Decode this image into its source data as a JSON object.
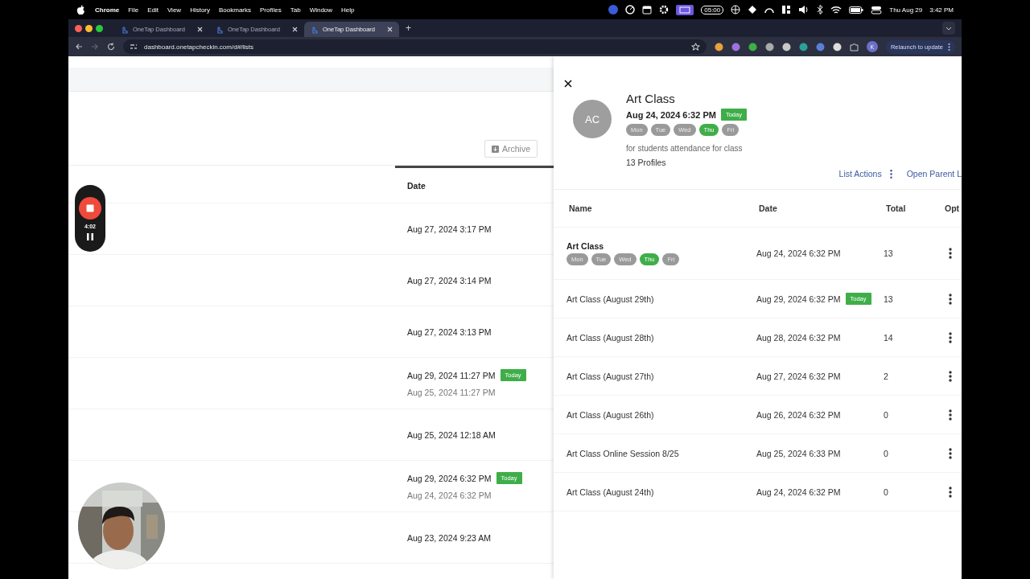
{
  "menu_bar": {
    "app": "Chrome",
    "items": [
      "File",
      "Edit",
      "View",
      "History",
      "Bookmarks",
      "Profiles",
      "Tab",
      "Window",
      "Help"
    ],
    "timer": "05:00",
    "date": "Thu Aug 29",
    "time": "3:42 PM"
  },
  "browser": {
    "tabs": [
      {
        "title": "OneTap Dashboard",
        "selected": false
      },
      {
        "title": "OneTap Dashboard",
        "selected": false
      },
      {
        "title": "OneTap Dashboard",
        "selected": true
      }
    ],
    "new_tab": "+",
    "url": "dashboard.onetapcheckin.com/d#/lists",
    "profile": "K",
    "relaunch": "Relaunch to update"
  },
  "list_page": {
    "archive_button": "Archive",
    "date_header": "Date",
    "rows": [
      {
        "date": "Aug 27, 2024 3:17 PM"
      },
      {
        "date": "Aug 27, 2024 3:14 PM"
      },
      {
        "date": "Aug 27, 2024 3:13 PM"
      },
      {
        "date": "Aug 29, 2024 11:27 PM",
        "badge": "Today",
        "original_date": "Aug 25, 2024 11:27 PM"
      },
      {
        "date": "Aug 25, 2024 12:18 AM"
      },
      {
        "date": "Aug 29, 2024 6:32 PM",
        "badge": "Today",
        "original_date": "Aug 24, 2024 6:32 PM"
      },
      {
        "date": "Aug 23, 2024 9:23 AM"
      }
    ]
  },
  "recorder": {
    "elapsed": "4:02"
  },
  "detail_panel": {
    "initials": "AC",
    "title": "Art Class",
    "date": "Aug 24, 2024 6:32 PM",
    "badge": "Today",
    "days": [
      {
        "label": "Mon",
        "selected": false
      },
      {
        "label": "Tue",
        "selected": false
      },
      {
        "label": "Wed",
        "selected": false
      },
      {
        "label": "Thu",
        "selected": true
      },
      {
        "label": "Fri",
        "selected": false
      }
    ],
    "description": "for students attendance for class",
    "profiles": "13 Profiles",
    "list_actions": "List Actions",
    "open_parent": "Open Parent L",
    "columns": [
      "Name",
      "Date",
      "Total",
      "Opt"
    ],
    "rows": [
      {
        "kind": "recurring",
        "name": "Art Class",
        "days": [
          {
            "label": "Mon",
            "selected": false
          },
          {
            "label": "Tue",
            "selected": false
          },
          {
            "label": "Wed",
            "selected": false
          },
          {
            "label": "Thu",
            "selected": true
          },
          {
            "label": "Fri",
            "selected": false
          }
        ],
        "date": "Aug 24, 2024 6:32 PM",
        "total": "13"
      },
      {
        "kind": "session",
        "name": "Art Class (August 29th)",
        "date": "Aug 29, 2024 6:32 PM",
        "badge": "Today",
        "total": "13"
      },
      {
        "kind": "session",
        "name": "Art Class (August 28th)",
        "date": "Aug 28, 2024 6:32 PM",
        "total": "14"
      },
      {
        "kind": "session",
        "name": "Art Class (August 27th)",
        "date": "Aug 27, 2024 6:32 PM",
        "total": "2"
      },
      {
        "kind": "session",
        "name": "Art Class (August 26th)",
        "date": "Aug 26, 2024 6:32 PM",
        "total": "0"
      },
      {
        "kind": "session",
        "name": "Art Class Online Session 8/25",
        "date": "Aug 25, 2024 6:33 PM",
        "total": "0"
      },
      {
        "kind": "session",
        "name": "Art Class (August 24th)",
        "date": "Aug 24, 2024 6:32 PM",
        "total": "0"
      }
    ]
  }
}
